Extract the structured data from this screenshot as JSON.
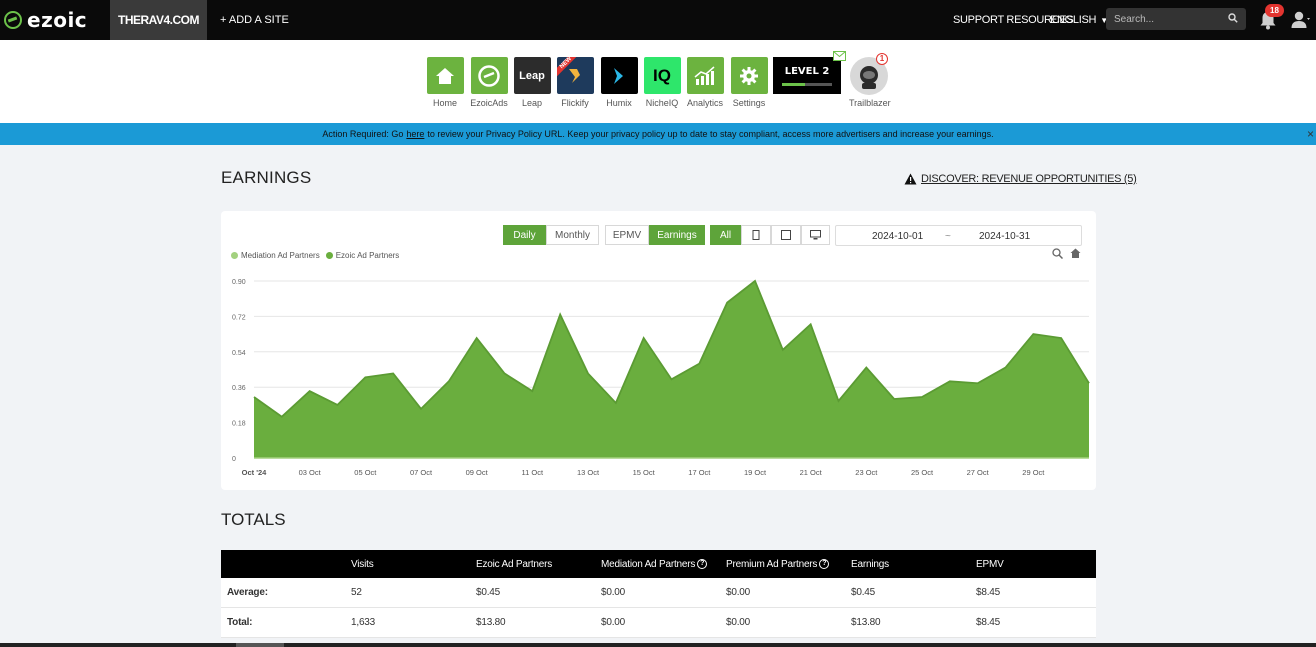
{
  "navbar": {
    "logo_text": "ezoic",
    "site_name": "THERAV4.COM",
    "add_site": "+ ADD A SITE",
    "support": "SUPPORT RESOURCES",
    "language": "ENGLISH",
    "search_placeholder": "Search...",
    "notification_count": "18",
    "colors": {
      "background": "#0a0a0a",
      "brand": "#6cc24a"
    }
  },
  "apps": [
    {
      "label": "Home",
      "icon": "home-icon"
    },
    {
      "label": "EzoicAds",
      "icon": "ezoicads-icon"
    },
    {
      "label": "Leap",
      "icon": "leap-icon",
      "tile_text": "Leap"
    },
    {
      "label": "Flickify",
      "icon": "flickify-icon",
      "ribbon": "NEW"
    },
    {
      "label": "Humix",
      "icon": "humix-icon"
    },
    {
      "label": "NicheIQ",
      "icon": "nicheiq-icon",
      "tile_text": "IQ"
    },
    {
      "label": "Analytics",
      "icon": "analytics-icon"
    },
    {
      "label": "Settings",
      "icon": "gear-icon"
    }
  ],
  "level": {
    "text": "LEVEL 2",
    "progress": 0.45
  },
  "trailblazer": {
    "label": "Trailblazer",
    "badge": "1"
  },
  "banner": {
    "prefix": "Action Required: Go",
    "link": "here",
    "suffix": "to review your Privacy Policy URL. Keep your privacy policy up to date to stay compliant, access more advertisers and increase your earnings.",
    "close": "×"
  },
  "earnings": {
    "title": "EARNINGS",
    "discover": "DISCOVER: REVENUE OPPORTUNITIES (5)",
    "controls": {
      "daily": "Daily",
      "monthly": "Monthly",
      "epmv": "EPMV",
      "earnings": "Earnings",
      "all": "All"
    },
    "date_from": "2024-10-01",
    "date_sep": "~",
    "date_to": "2024-10-31",
    "legend": [
      {
        "name": "Mediation Ad Partners",
        "color": "#a3d17f"
      },
      {
        "name": "Ezoic Ad Partners",
        "color": "#6aae3e"
      }
    ]
  },
  "chart_data": {
    "type": "area",
    "x": [
      "2024-10-01",
      "2024-10-02",
      "2024-10-03",
      "2024-10-04",
      "2024-10-05",
      "2024-10-06",
      "2024-10-07",
      "2024-10-08",
      "2024-10-09",
      "2024-10-10",
      "2024-10-11",
      "2024-10-12",
      "2024-10-13",
      "2024-10-14",
      "2024-10-15",
      "2024-10-16",
      "2024-10-17",
      "2024-10-18",
      "2024-10-19",
      "2024-10-20",
      "2024-10-21",
      "2024-10-22",
      "2024-10-23",
      "2024-10-24",
      "2024-10-25",
      "2024-10-26",
      "2024-10-27",
      "2024-10-28",
      "2024-10-29",
      "2024-10-30",
      "2024-10-31"
    ],
    "series": [
      {
        "name": "Mediation Ad Partners",
        "values": [
          0,
          0,
          0,
          0,
          0,
          0,
          0,
          0,
          0,
          0,
          0,
          0,
          0,
          0,
          0,
          0,
          0,
          0,
          0,
          0,
          0,
          0,
          0,
          0,
          0,
          0,
          0,
          0,
          0,
          0,
          0
        ]
      },
      {
        "name": "Ezoic Ad Partners",
        "values": [
          0.31,
          0.21,
          0.34,
          0.27,
          0.41,
          0.43,
          0.25,
          0.39,
          0.61,
          0.43,
          0.34,
          0.73,
          0.43,
          0.28,
          0.61,
          0.4,
          0.48,
          0.79,
          0.9,
          0.55,
          0.68,
          0.29,
          0.46,
          0.3,
          0.31,
          0.39,
          0.38,
          0.46,
          0.63,
          0.61,
          0.38
        ]
      }
    ],
    "y_ticks": [
      "0.90",
      "0.72",
      "0.54",
      "0.36",
      "0.18",
      "0"
    ],
    "x_ticks": [
      "Oct '24",
      "03 Oct",
      "05 Oct",
      "07 Oct",
      "09 Oct",
      "11 Oct",
      "13 Oct",
      "15 Oct",
      "17 Oct",
      "19 Oct",
      "21 Oct",
      "23 Oct",
      "25 Oct",
      "27 Oct",
      "29 Oct"
    ],
    "ylim": [
      0,
      0.9
    ],
    "grid": true,
    "legend_position": "top-left",
    "colors": {
      "fill": "#6aae3e",
      "stroke": "#5b9b33"
    }
  },
  "totals": {
    "title": "TOTALS",
    "headers": [
      "",
      "Visits",
      "Ezoic Ad Partners",
      "Mediation Ad Partners",
      "Premium Ad Partners",
      "Earnings",
      "EPMV"
    ],
    "rows": [
      [
        "Average:",
        "52",
        "$0.45",
        "$0.00",
        "$0.00",
        "$0.45",
        "$8.45"
      ],
      [
        "Total:",
        "1,633",
        "$13.80",
        "$0.00",
        "$0.00",
        "$13.80",
        "$8.45"
      ]
    ]
  }
}
